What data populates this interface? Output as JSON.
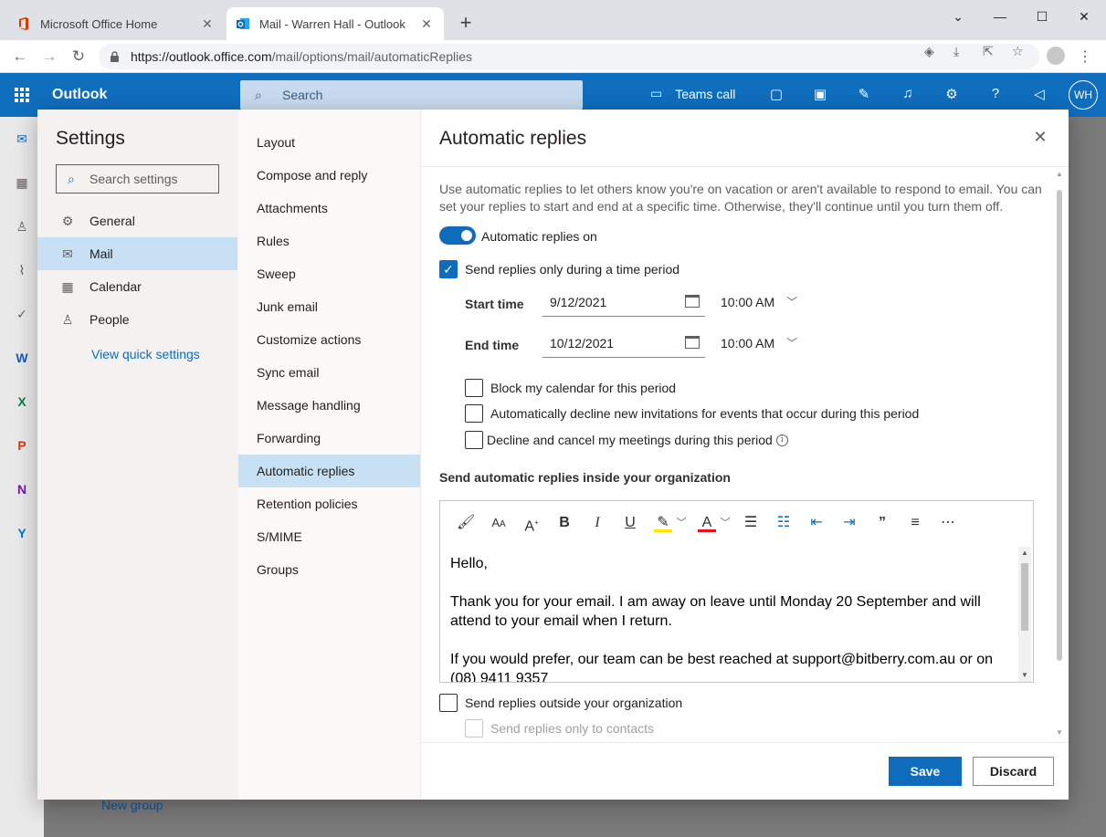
{
  "browser": {
    "tabs": [
      {
        "title": "Microsoft Office Home",
        "active": false,
        "close": "✕"
      },
      {
        "title": "Mail - Warren Hall - Outlook",
        "active": true,
        "close": "✕"
      }
    ],
    "new_tab": "+",
    "url_host": "https://outlook.office.com",
    "url_path": "/mail/options/mail/automaticReplies"
  },
  "owa": {
    "brand": "Outlook",
    "search_placeholder": "Search",
    "teams_call": "Teams call",
    "avatar_initials": "WH",
    "background_link": "New group"
  },
  "settings": {
    "title": "Settings",
    "search_placeholder": "Search settings",
    "categories": [
      {
        "label": "General",
        "icon": "gear-icon"
      },
      {
        "label": "Mail",
        "icon": "mail-icon",
        "selected": true
      },
      {
        "label": "Calendar",
        "icon": "calendar-icon"
      },
      {
        "label": "People",
        "icon": "people-icon"
      }
    ],
    "quick_settings_link": "View quick settings",
    "mail_sections": [
      "Layout",
      "Compose and reply",
      "Attachments",
      "Rules",
      "Sweep",
      "Junk email",
      "Customize actions",
      "Sync email",
      "Message handling",
      "Forwarding",
      "Automatic replies",
      "Retention policies",
      "S/MIME",
      "Groups"
    ],
    "selected_section": "Automatic replies"
  },
  "automatic_replies": {
    "title": "Automatic replies",
    "description": "Use automatic replies to let others know you're on vacation or aren't available to respond to email. You can set your replies to start and end at a specific time. Otherwise, they'll continue until you turn them off.",
    "toggle_label": "Automatic replies on",
    "toggle_on": true,
    "time_period_label": "Send replies only during a time period",
    "time_period_checked": true,
    "start_label": "Start time",
    "start_date": "9/12/2021",
    "start_time": "10:00 AM",
    "end_label": "End time",
    "end_date": "10/12/2021",
    "end_time": "10:00 AM",
    "block_calendar_label": "Block my calendar for this period",
    "decline_invites_label": "Automatically decline new invitations for events that occur during this period",
    "decline_cancel_label": "Decline and cancel my meetings during this period",
    "inside_org_heading": "Send automatic replies inside your organization",
    "message": {
      "greeting": "Hello,",
      "para1": "Thank you for your email. I am away on leave until Monday 20 September and will attend to your email when I return.",
      "para2": "If you would prefer, our team can be best reached at support@bitberry.com.au or on (08) 9411 9357"
    },
    "outside_org_label": "Send replies outside your organization",
    "outside_org_checked": false,
    "contacts_only_label": "Send replies only to contacts",
    "save_label": "Save",
    "discard_label": "Discard"
  },
  "colors": {
    "accent": "#0f6cbd",
    "header": "#106ebe",
    "selected_nav": "#c7e0f4"
  }
}
